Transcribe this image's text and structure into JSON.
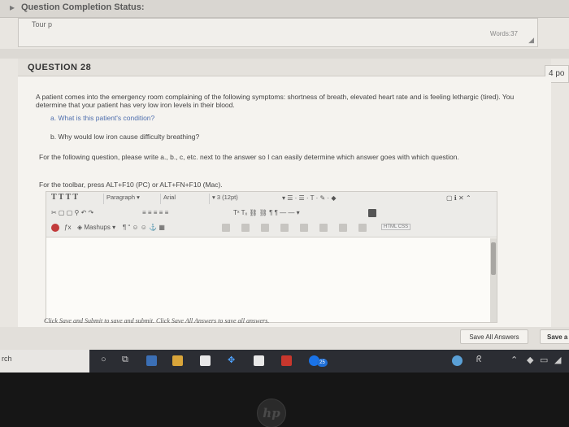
{
  "status_bar": {
    "title": "Question Completion Status:"
  },
  "previous_answer": {
    "left_fragment": "Tour p",
    "right_fragment": "Words:37"
  },
  "question": {
    "title": "QUESTION 28",
    "points": "4 po",
    "main_text": "A patient comes into the emergency room complaining of the following symptoms: shortness of breath, elevated heart rate and is feeling lethargic (tired). You determine that your patient has very low iron levels in their blood.",
    "part_a_label": "a.",
    "part_a_text": "What is this patient's condition?",
    "part_b_label": "b.",
    "part_b_text": "Why would low iron cause difficulty breathing?",
    "instructions": "For the following question, please write a., b., c, etc. next to the answer so I can easily determine which answer goes with which question.",
    "toolbar_help": "For the toolbar, press ALT+F10 (PC) or ALT+FN+F10 (Mac)."
  },
  "editor_toolbar": {
    "row1": {
      "format_buttons": "T T T T",
      "paragraph": "Paragraph",
      "font": "Arial",
      "size": "3 (12pt)"
    },
    "row3": {
      "mashups": "Mashups",
      "html_css": "HTML CSS"
    }
  },
  "footer": {
    "note": "Click Save and Submit to save and submit. Click Save All Answers to save all answers.",
    "save_all": "Save All Answers",
    "save_submit": "Save a"
  },
  "taskbar": {
    "search_text": "rch",
    "badge": "25"
  },
  "bezel": {
    "logo": "hp"
  },
  "colors": {
    "link_blue": "#4f6fae",
    "taskbar": "#2b2d33",
    "badge_blue": "#1f6fd6"
  }
}
